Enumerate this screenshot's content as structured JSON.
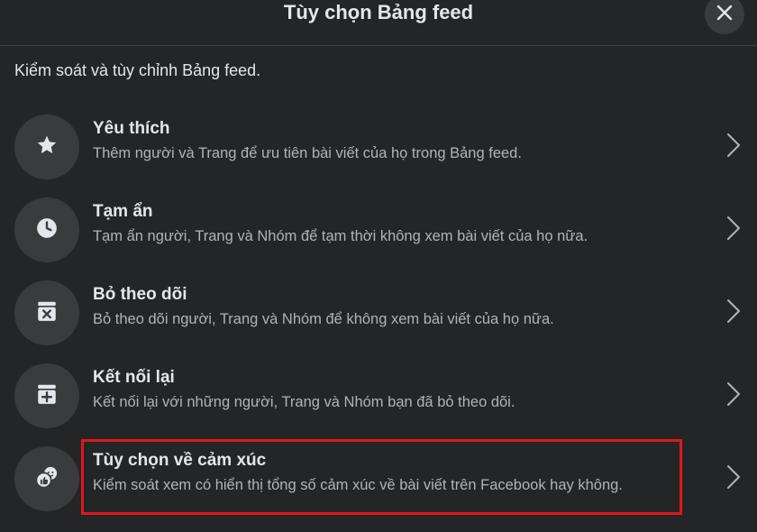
{
  "dialog": {
    "title": "Tùy chọn Bảng feed",
    "close_icon": "close-icon",
    "subtitle": "Kiểm soát và tùy chỉnh Bảng feed."
  },
  "items": [
    {
      "label": "Yêu thích",
      "description": "Thêm người và Trang để ưu tiên bài viết của họ trong Bảng feed.",
      "icon": "star-icon"
    },
    {
      "label": "Tạm ẩn",
      "description": "Tạm ẩn người, Trang và Nhóm để tạm thời không xem bài viết của họ nữa.",
      "icon": "clock-icon"
    },
    {
      "label": "Bỏ theo dõi",
      "description": "Bỏ theo dõi người, Trang và Nhóm để không xem bài viết của họ nữa.",
      "icon": "unfollow-icon"
    },
    {
      "label": "Kết nối lại",
      "description": "Kết nối lại với những người, Trang và Nhóm bạn đã bỏ theo dõi.",
      "icon": "reconnect-icon"
    },
    {
      "label": "Tùy chọn về cảm xúc",
      "description": "Kiểm soát xem có hiển thị tổng số cảm xúc về bài viết trên Facebook hay không.",
      "icon": "reactions-icon",
      "highlighted": true
    }
  ],
  "colors": {
    "background": "#242526",
    "icon_circle": "#3a3b3c",
    "primary_text": "#e4e6eb",
    "secondary_text": "#b0b3b8",
    "highlight_border": "#e0161b"
  }
}
